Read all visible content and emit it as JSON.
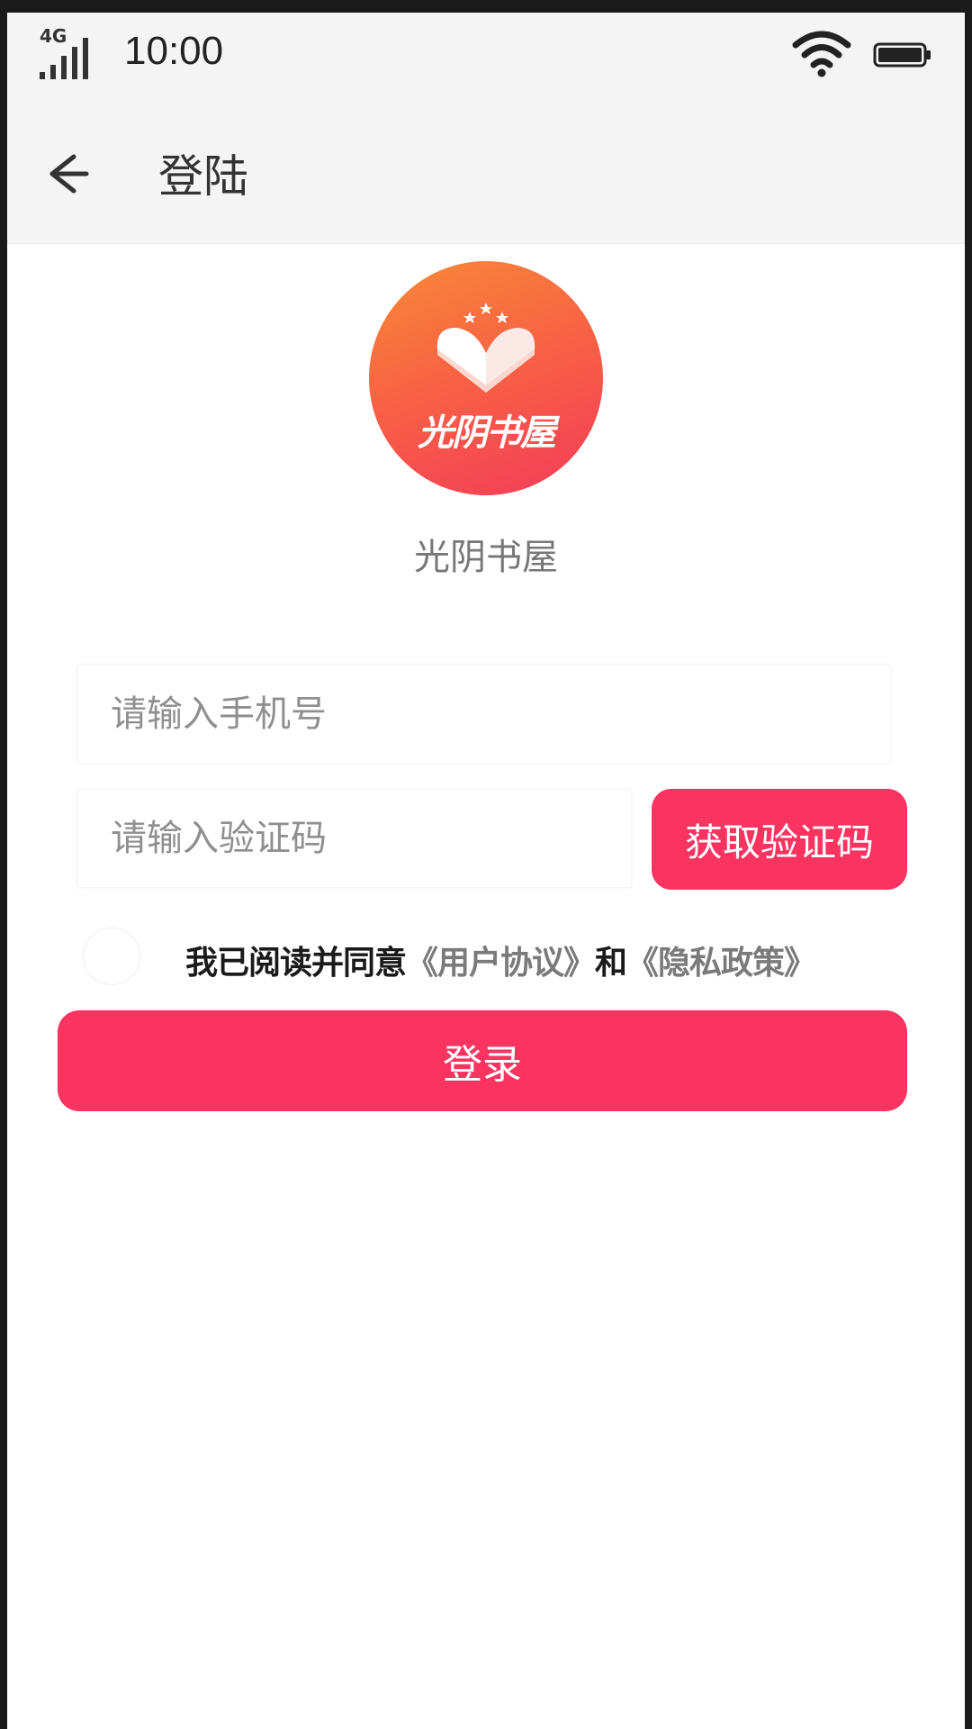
{
  "status_bar": {
    "network": "4G",
    "time": "10:00",
    "icons": [
      "signal-icon",
      "wifi-icon",
      "battery-icon"
    ]
  },
  "nav": {
    "title": "登陆",
    "back_icon": "back-arrow-icon"
  },
  "brand": {
    "logo_text": "光阴书屋",
    "app_name": "光阴书屋"
  },
  "form": {
    "phone_placeholder": "请输入手机号",
    "phone_value": "",
    "code_placeholder": "请输入验证码",
    "code_value": "",
    "get_code_label": "获取验证码"
  },
  "agreement": {
    "checked": false,
    "prefix": "我已阅读并同意",
    "user_agreement": "《用户协议》",
    "conjunction": "和",
    "privacy_policy": "《隐私政策》"
  },
  "login_label": "登录",
  "colors": {
    "accent": "#f93461",
    "logo_gradient_start": "#f98a38",
    "logo_gradient_end": "#f43b5a",
    "header_bg": "#f4f4f4"
  }
}
